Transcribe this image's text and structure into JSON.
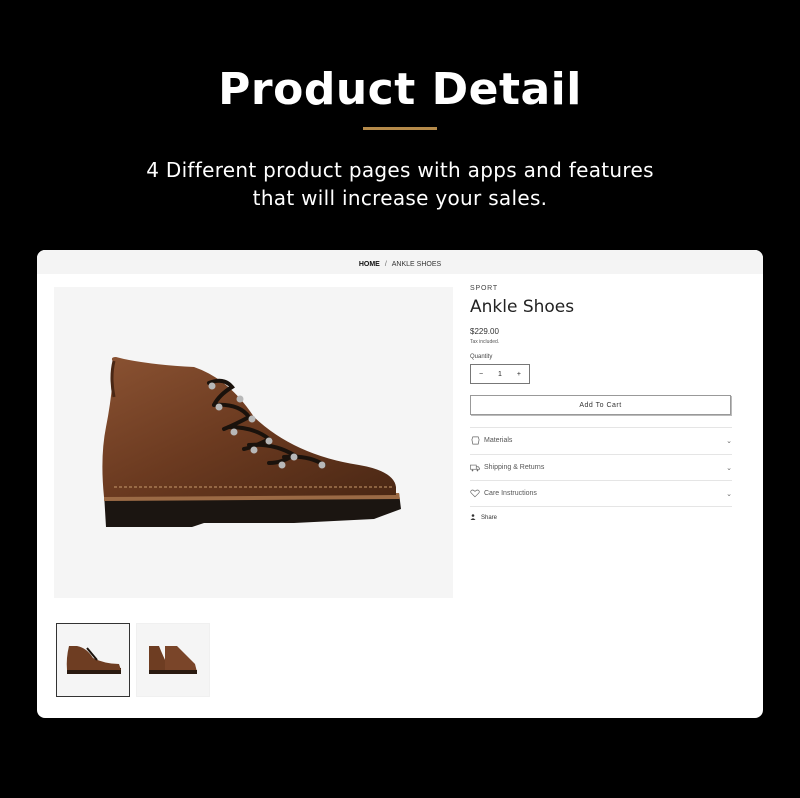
{
  "hero": {
    "title": "Product Detail",
    "subtitle_line1": "4 Different product pages with apps and features",
    "subtitle_line2": "that will increase your sales.",
    "accent_color": "#b58a4a"
  },
  "breadcrumb": {
    "home": "HOME",
    "separator": "/",
    "current": "ANKLE SHOES"
  },
  "product": {
    "vendor": "SPORT",
    "title": "Ankle Shoes",
    "price": "$229.00",
    "tax_note": "Tax included.",
    "quantity_label": "Quantity",
    "quantity_value": "1",
    "minus": "−",
    "plus": "+",
    "add_to_cart": "Add To Cart",
    "share": "Share"
  },
  "accordions": [
    {
      "label": "Materials",
      "icon": "leather-icon"
    },
    {
      "label": "Shipping & Returns",
      "icon": "truck-icon"
    },
    {
      "label": "Care Instructions",
      "icon": "heart-icon"
    }
  ],
  "chevron": "⌄"
}
